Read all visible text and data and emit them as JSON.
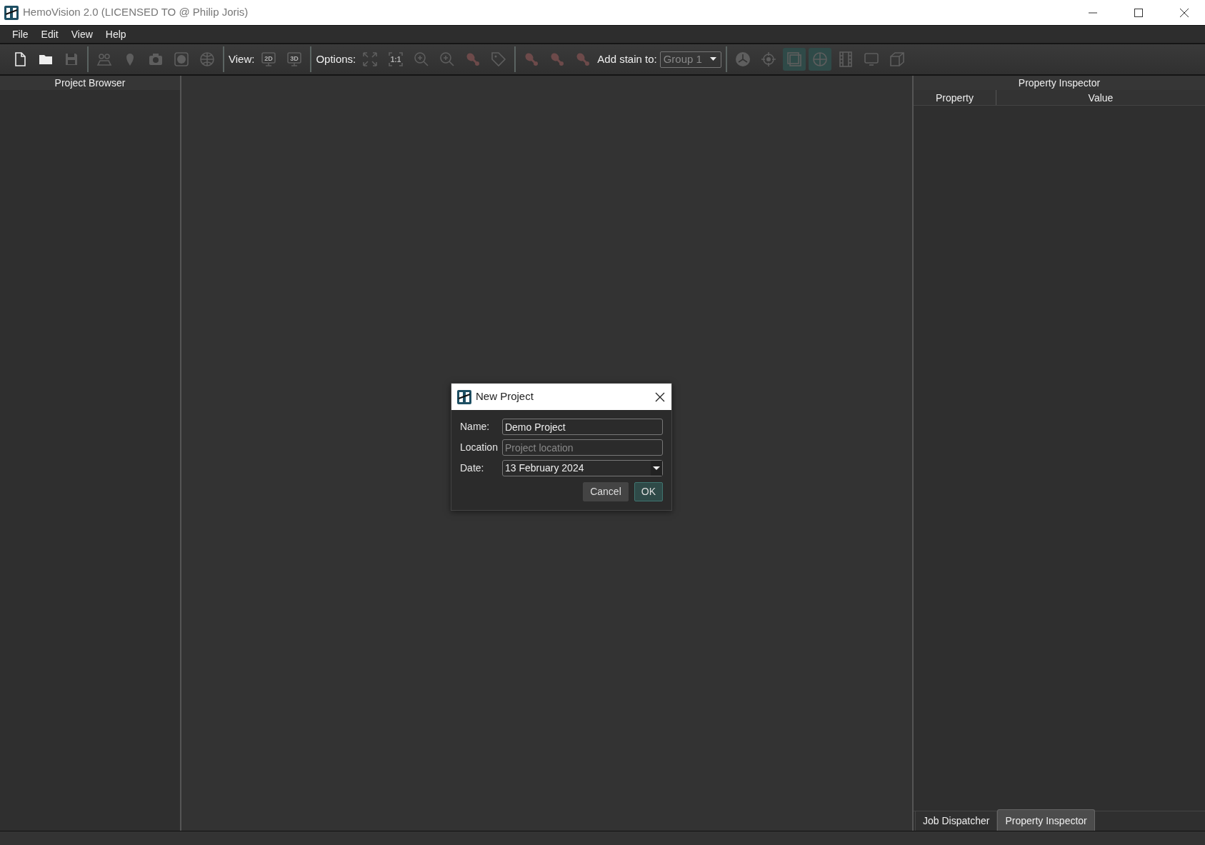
{
  "window": {
    "title": "HemoVision 2.0 (LICENSED TO @ Philip Joris)"
  },
  "menu": [
    "File",
    "Edit",
    "View",
    "Help"
  ],
  "toolbar": {
    "groups": [
      {
        "items": [
          {
            "kind": "button",
            "disabled": false,
            "checked": false
          },
          {
            "kind": "button",
            "disabled": false,
            "checked": false
          },
          {
            "kind": "button",
            "disabled": true,
            "checked": false
          }
        ]
      },
      {
        "items": [
          {
            "kind": "button",
            "disabled": true,
            "checked": false
          },
          {
            "kind": "button",
            "disabled": true,
            "checked": false
          },
          {
            "kind": "button",
            "disabled": true,
            "checked": false
          },
          {
            "kind": "button",
            "disabled": true,
            "checked": false
          },
          {
            "kind": "button",
            "disabled": true,
            "checked": false
          }
        ]
      },
      {
        "items": [
          {
            "kind": "label",
            "text": "View:"
          },
          {
            "kind": "button",
            "disabled": true,
            "checked": false,
            "text": "2D"
          },
          {
            "kind": "button",
            "disabled": true,
            "checked": false,
            "text": "3D"
          }
        ]
      },
      {
        "items": [
          {
            "kind": "label",
            "text": "Options:"
          },
          {
            "kind": "button",
            "disabled": true,
            "checked": false
          },
          {
            "kind": "button",
            "disabled": true,
            "checked": false,
            "text": "1:1"
          },
          {
            "kind": "button",
            "disabled": true,
            "checked": false
          },
          {
            "kind": "button",
            "disabled": true,
            "checked": false
          },
          {
            "kind": "button",
            "disabled": true,
            "checked": false
          },
          {
            "kind": "button",
            "disabled": true,
            "checked": false
          }
        ]
      },
      {
        "items": [
          {
            "kind": "button",
            "disabled": true,
            "checked": false
          },
          {
            "kind": "button",
            "disabled": true,
            "checked": false
          },
          {
            "kind": "button",
            "disabled": true,
            "checked": false
          },
          {
            "kind": "label",
            "text": "Add stain to:"
          },
          {
            "kind": "combo",
            "value": "Group 1",
            "disabled": true
          }
        ]
      },
      {
        "items": [
          {
            "kind": "button",
            "disabled": true,
            "checked": false
          },
          {
            "kind": "button",
            "disabled": true,
            "checked": false
          },
          {
            "kind": "button",
            "disabled": true,
            "checked": true
          },
          {
            "kind": "button",
            "disabled": true,
            "checked": true
          },
          {
            "kind": "button",
            "disabled": true,
            "checked": false
          },
          {
            "kind": "button",
            "disabled": true,
            "checked": false
          },
          {
            "kind": "button",
            "disabled": true,
            "checked": false
          }
        ]
      }
    ]
  },
  "project_browser": {
    "title": "Project Browser"
  },
  "property_inspector": {
    "title": "Property Inspector",
    "columns": [
      "Property",
      "Value"
    ]
  },
  "dock_tabs": [
    {
      "label": "Job Dispatcher",
      "selected": false
    },
    {
      "label": "Property Inspector",
      "selected": true
    }
  ],
  "dialog": {
    "title": "New Project",
    "fields": [
      {
        "kind": "text",
        "label": "Name:",
        "value": "Demo Project"
      },
      {
        "kind": "text",
        "label": "Location",
        "placeholder": "Project location"
      },
      {
        "kind": "date",
        "label": "Date:",
        "value": "13 February 2024"
      }
    ],
    "buttons": [
      {
        "label": "Cancel",
        "default": false
      },
      {
        "label": "OK",
        "default": true
      }
    ]
  }
}
